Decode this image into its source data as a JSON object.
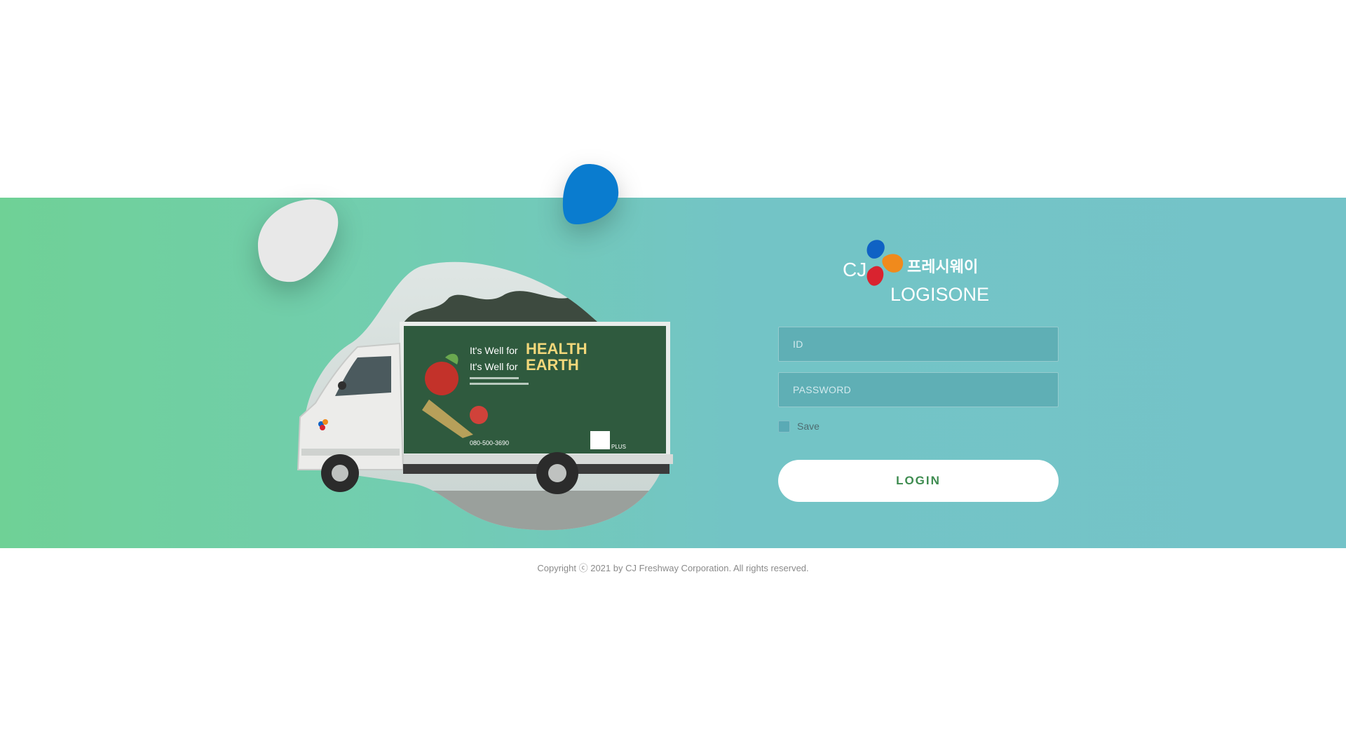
{
  "logo": {
    "brand": "CJ",
    "korean_name": "프레시웨이",
    "product": "LOGISONE",
    "petal_colors": [
      "#0f62c4",
      "#f08a1c",
      "#d9232f"
    ]
  },
  "hero": {
    "truck_headline_1_prefix": "It's Well for",
    "truck_headline_1_word": "HEALTH",
    "truck_headline_2_prefix": "It's Well for",
    "truck_headline_2_word": "EARTH",
    "truck_phone": "080-500-3690",
    "truck_badge": "PLUS"
  },
  "form": {
    "id_placeholder": "ID",
    "password_placeholder": "PASSWORD",
    "save_label": "Save",
    "login_label": "LOGIN"
  },
  "footer": {
    "copyright": "Copyright ⓒ 2021 by CJ Freshway Corporation. All rights reserved."
  },
  "colors": {
    "band_left": "#6fd196",
    "band_right": "#74c3c8",
    "accent_blue": "#0a7ccf",
    "blob_grey": "#e8e8e8",
    "login_text": "#3d8b4f"
  }
}
